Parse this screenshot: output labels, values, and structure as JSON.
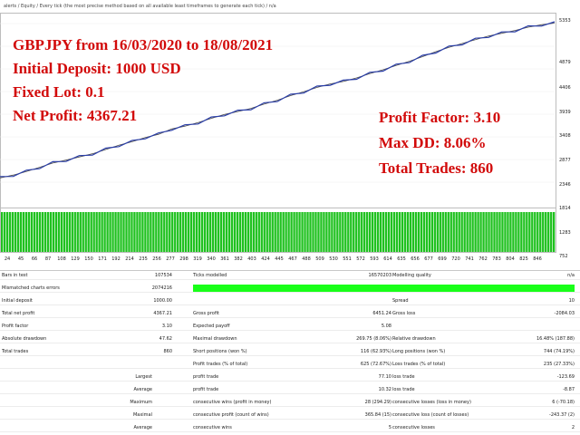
{
  "header": {
    "text": "alerts / Equity / Every tick (the most precise method based on all available least timeframes to generate each tick) / n/a"
  },
  "overlay": {
    "line1": "GBPJPY from 16/03/2020 to 18/08/2021",
    "line2": "Initial Deposit: 1000 USD",
    "line3": "Fixed Lot: 0.1",
    "line4": "Net Profit: 4367.21",
    "line5": "Profit Factor: 3.10",
    "line6": "Max DD: 8.06%",
    "line7": "Total Trades: 860"
  },
  "price_axis": [
    "5353",
    "4879",
    "4406",
    "3939",
    "3408",
    "2877",
    "2346",
    "1814",
    "1283",
    "752"
  ],
  "x_ticks": [
    "24",
    "45",
    "66",
    "87",
    "108",
    "129",
    "150",
    "171",
    "192",
    "214",
    "235",
    "256",
    "277",
    "298",
    "319",
    "340",
    "361",
    "382",
    "403",
    "424",
    "445",
    "467",
    "488",
    "509",
    "530",
    "551",
    "572",
    "593",
    "614",
    "635",
    "656",
    "677",
    "699",
    "720",
    "741",
    "762",
    "783",
    "804",
    "825",
    "846"
  ],
  "colors": {
    "equity_line": "#2a3ea8",
    "balance_line": "#4a4a4a",
    "volume_bars": "#1fc11f",
    "overlay_text": "#d20a0a",
    "quality_bar": "#19ff19"
  },
  "chart_data": {
    "type": "line",
    "series": [
      {
        "name": "",
        "values": [
          1000,
          1080,
          1180,
          1300,
          1420,
          1500,
          1590,
          1680,
          1800,
          1920,
          2020,
          2140,
          2230,
          2380,
          2460,
          2560,
          2680,
          2790,
          2870,
          2960,
          3080,
          3190,
          3320,
          3430,
          3550,
          3650,
          3720,
          3820,
          3940,
          4050,
          4170,
          4290,
          4420,
          4560,
          4680,
          4790,
          4900,
          5000,
          5080,
          5160,
          5250,
          5320,
          5367
        ]
      }
    ],
    "xlim": [
      0,
      860
    ],
    "ylim": [
      752,
      5353
    ]
  },
  "report": {
    "rows": [
      {
        "c1": "Bars in test",
        "c2": "107534",
        "c3": "Ticks modelled",
        "c4": "16570203",
        "c5": "Modelling quality",
        "c6": "n/a"
      },
      {
        "c1": "Mismatched charts errors",
        "c2": "2074216",
        "c3": "",
        "c4": "",
        "c5": "",
        "c6": ""
      },
      {
        "c1": "Initial deposit",
        "c2": "1000.00",
        "c3": "",
        "c4": "",
        "c5": "Spread",
        "c6": "10"
      },
      {
        "c1": "Total net profit",
        "c2": "4367.21",
        "c3": "Gross profit",
        "c4": "6451.24",
        "c5": "Gross loss",
        "c6": "-2084.03"
      },
      {
        "c1": "Profit factor",
        "c2": "3.10",
        "c3": "Expected payoff",
        "c4": "5.08",
        "c5": "",
        "c6": ""
      },
      {
        "c1": "Absolute drawdown",
        "c2": "47.62",
        "c3": "Maximal drawdown",
        "c4": "269.75 (8.06%)",
        "c5": "Relative drawdown",
        "c6": "16.48% (187.88)"
      },
      {
        "c1": "Total trades",
        "c2": "860",
        "c3": "Short positions (won %)",
        "c4": "116 (62.93%)",
        "c5": "Long positions (won %)",
        "c6": "744 (74.19%)"
      },
      {
        "c1": "",
        "c2": "",
        "c3": "Profit trades (% of total)",
        "c4": "625 (72.67%)",
        "c5": "Loss trades (% of total)",
        "c6": "235 (27.33%)"
      },
      {
        "c1": "Largest",
        "c2": "",
        "c3": "profit trade",
        "c4": "77.10",
        "c5": "loss trade",
        "c6": "-123.69"
      },
      {
        "c1": "Average",
        "c2": "",
        "c3": "profit trade",
        "c4": "10.32",
        "c5": "loss trade",
        "c6": "-8.87"
      },
      {
        "c1": "Maximum",
        "c2": "",
        "c3": "consecutive wins (profit in money)",
        "c4": "28 (294.29)",
        "c5": "consecutive losses (loss in money)",
        "c6": "6 (-70.18)"
      },
      {
        "c1": "Maximal",
        "c2": "",
        "c3": "consecutive profit (count of wins)",
        "c4": "365.84 (15)",
        "c5": "consecutive loss (count of losses)",
        "c6": "-243.37 (2)"
      },
      {
        "c1": "Average",
        "c2": "",
        "c3": "consecutive wins",
        "c4": "5",
        "c5": "consecutive losses",
        "c6": "2"
      }
    ]
  }
}
